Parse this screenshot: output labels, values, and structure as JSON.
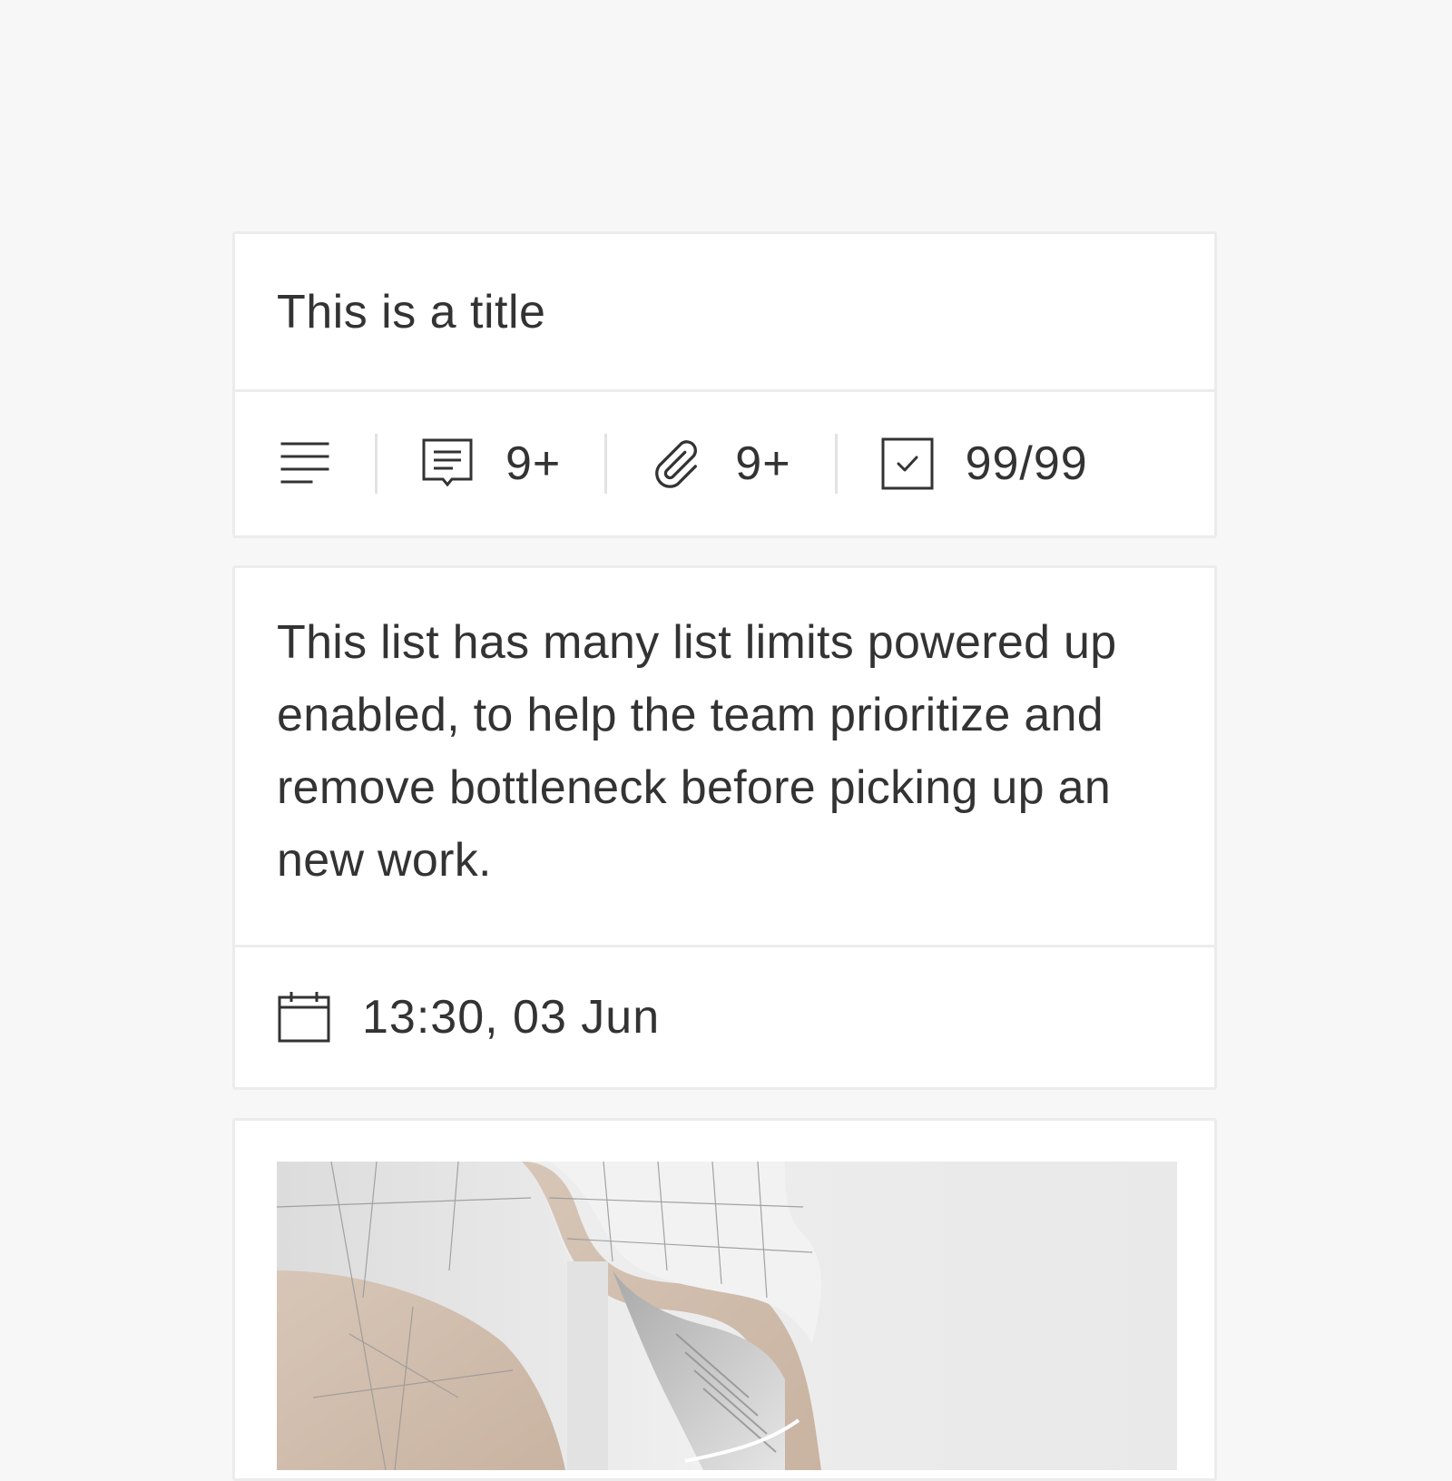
{
  "card": {
    "title": "This is a title",
    "badges": {
      "description_icon": "text-lines-icon",
      "comments": {
        "icon": "comment-icon",
        "count": "9+"
      },
      "attachments": {
        "icon": "paperclip-icon",
        "count": "9+"
      },
      "checklist": {
        "icon": "checkbox-icon",
        "count": "99/99"
      }
    }
  },
  "detail": {
    "description": "This list has many list limits powered up enabled, to help the team prioritize and remove bottleneck before picking up an new work.",
    "due": {
      "icon": "calendar-icon",
      "text": "13:30, 03 Jun"
    }
  },
  "cover": {
    "image": "architecture-photo"
  },
  "colors": {
    "background": "#f7f7f7",
    "card": "#ffffff",
    "border": "#ececec",
    "text": "#333333"
  }
}
